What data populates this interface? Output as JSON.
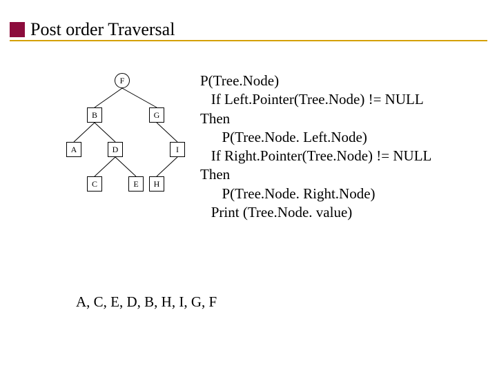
{
  "title": "Post order Traversal",
  "tree": {
    "F": "F",
    "B": "B",
    "G": "G",
    "A": "A",
    "D": "D",
    "I": "I",
    "C": "C",
    "E": "E",
    "H": "H"
  },
  "pseudo": {
    "l1": "P(Tree.Node)",
    "l2": "   If Left.Pointer(Tree.Node) != NULL",
    "l3": "Then",
    "l4": "      P(Tree.Node. Left.Node)",
    "l5": "   If Right.Pointer(Tree.Node) != NULL",
    "l6": "Then",
    "l7": "      P(Tree.Node. Right.Node)",
    "l8": "   Print (Tree.Node. value)"
  },
  "output": "A, C, E, D, B, H, I, G, F"
}
